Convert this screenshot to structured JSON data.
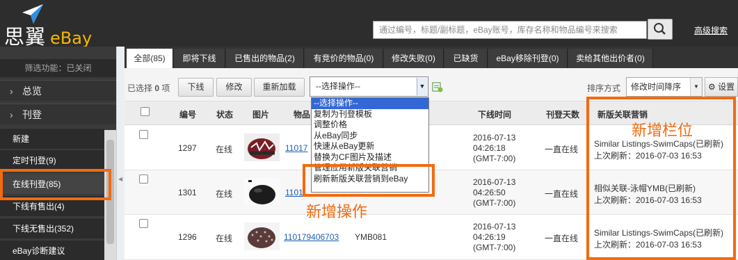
{
  "brand": {
    "name": "思翼",
    "sub": "eBay"
  },
  "search": {
    "placeholder": "通过编号，标题/副标题，eBay账号，库存名称和物品编号来搜索"
  },
  "header": {
    "advanced_search": "高级搜索"
  },
  "sidebar": {
    "filter_status": "筛选功能：已关闭",
    "groups": [
      {
        "label": "总览"
      },
      {
        "label": "刊登"
      }
    ],
    "items": [
      {
        "label": "新建"
      },
      {
        "label": "定时刊登(9)"
      },
      {
        "label": "在线刊登(85)"
      },
      {
        "label": "下线有售出(4)"
      },
      {
        "label": "下线无售出(352)"
      },
      {
        "label": "eBay诊断建议"
      }
    ]
  },
  "tabs": [
    {
      "label": "全部(85)"
    },
    {
      "label": "即将下线"
    },
    {
      "label": "已售出的物品(2)"
    },
    {
      "label": "有竞价的物品(0)"
    },
    {
      "label": "修改失败(0)"
    },
    {
      "label": "已缺货"
    },
    {
      "label": "eBay移除刊登(0)"
    },
    {
      "label": "卖给其他出价者(0)"
    }
  ],
  "toolbar": {
    "selected_prefix": "已选择",
    "selected_count": "0",
    "selected_suffix": "项",
    "offline_button": "下线",
    "edit_button": "修改",
    "reload_button": "重新加载",
    "operation_select": "--选择操作--",
    "sort_label": "排序方式",
    "sort_value": "修改时间降序",
    "settings_button": "设置"
  },
  "dropdown": {
    "options": [
      "--选择操作--",
      "复制为刊登模板",
      "调整价格",
      "从eBay同步",
      "快速从eBay更新",
      "替换为CF图片及描述",
      "管理应用新版关联营销",
      "刷新新版关联营销到eBay"
    ]
  },
  "table": {
    "headers": {
      "id": "编号",
      "status": "状态",
      "image": "图片",
      "item": "物品",
      "offline_time": "下线时间",
      "listing_days": "刊登天数",
      "related": "新版关联营销"
    },
    "rows": [
      {
        "id": "1297",
        "status": "在线",
        "item_no": "11017",
        "sku": "",
        "time_date": "2016-07-13",
        "time_clock": "04:26:18",
        "time_zone": "(GMT-7:00)",
        "days": "一直在线",
        "related_title": "Similar Listings-SwimCaps(已刷新)",
        "related_refresh": "上次刷新：2016-07-03 16:53"
      },
      {
        "id": "1301",
        "status": "在线",
        "item_no": "1101",
        "sku": "",
        "time_date": "2016-07-13",
        "time_clock": "04:26:50",
        "time_zone": "(GMT-7:00)",
        "days": "一直在线",
        "related_title": "相似关联-泳帽YMB(已刷新)",
        "related_refresh": "上次刷新：2016-07-03 16:53"
      },
      {
        "id": "1296",
        "status": "在线",
        "item_no": "110179406703",
        "sku": "YMB081",
        "time_date": "2016-07-13",
        "time_clock": "04:26:19",
        "time_zone": "(GMT-7:00)",
        "days": "一直在线",
        "related_title": "Similar Listings-SwimCaps(已刷新)",
        "related_refresh": "上次刷新：2016-07-03 16:53"
      }
    ]
  },
  "annotations": {
    "new_column": "新增栏位",
    "new_operation": "新增操作"
  },
  "colors": {
    "highlight": "#f26b10",
    "topbar": "#2d2d2d",
    "sidebar": "#3a3a3a",
    "link": "#1a5fb4"
  },
  "icons": [
    "logo-plane-icon",
    "search-icon",
    "chevron-right-icon",
    "export-excel-icon",
    "gear-icon",
    "dropdown-arrow-icon",
    "checkbox-icon"
  ]
}
